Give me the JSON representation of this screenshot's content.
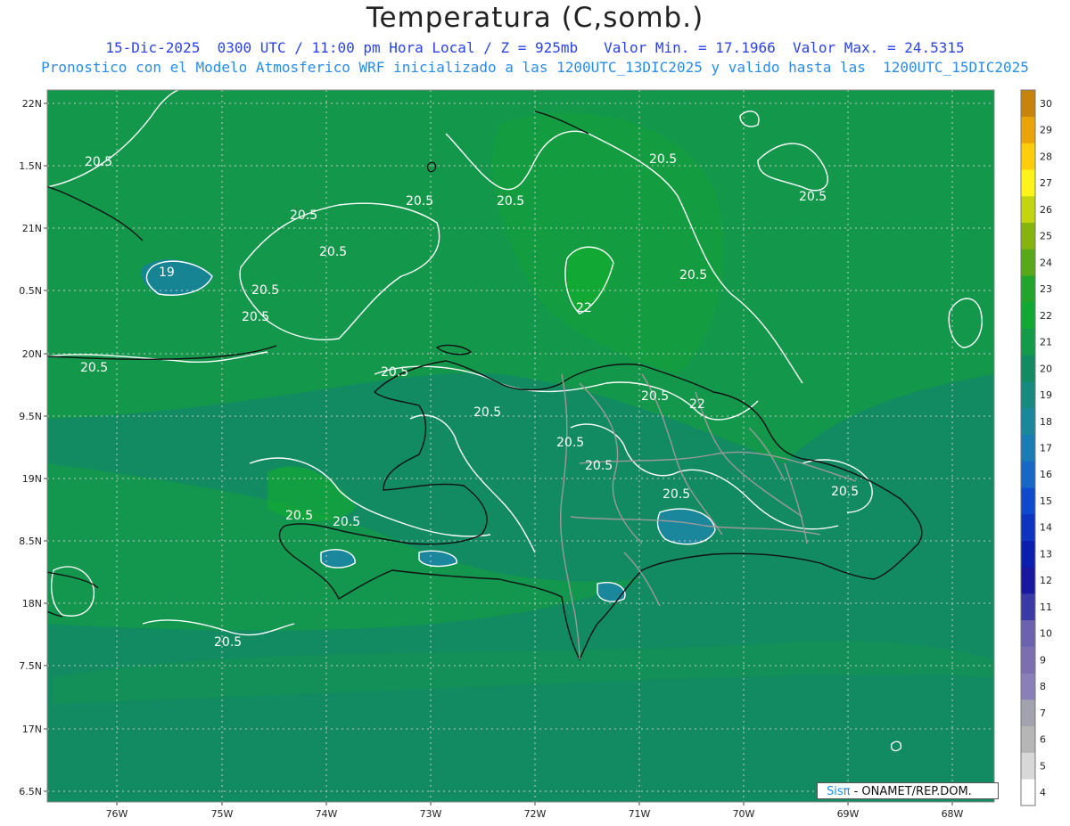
{
  "header": {
    "title": "Temperatura (C,somb.)",
    "subtitle1": "15-Dic-2025  0300 UTC / 11:00 pm Hora Local / Z = 925mb   Valor Min. = 17.1966  Valor Max. = 24.5315",
    "subtitle2": "Pronostico con el Modelo Atmosferico WRF inicializado a las 1200UTC_13DIC2025 y valido hasta las  1200UTC_15DIC2025"
  },
  "axes": {
    "lat_labels": [
      "22N",
      "1.5N",
      "21N",
      "0.5N",
      "20N",
      "9.5N",
      "19N",
      "8.5N",
      "18N",
      "7.5N",
      "17N",
      "6.5N"
    ],
    "lon_labels": [
      "76W",
      "75W",
      "74W",
      "73W",
      "72W",
      "71W",
      "70W",
      "69W",
      "68W"
    ]
  },
  "colorbar": {
    "labels": [
      "4",
      "5",
      "6",
      "7",
      "8",
      "9",
      "10",
      "11",
      "12",
      "13",
      "14",
      "15",
      "16",
      "17",
      "18",
      "19",
      "20",
      "21",
      "22",
      "23",
      "24",
      "25",
      "26",
      "27",
      "28",
      "29",
      "30"
    ],
    "colors": [
      "#ffffff",
      "#d8d8d8",
      "#b6b6b6",
      "#a3a3b0",
      "#8a7fb8",
      "#7b6fb2",
      "#6a62b0",
      "#3a3aa6",
      "#1717a0",
      "#0b1fae",
      "#0c34be",
      "#0d4bcc",
      "#1667c6",
      "#1a7cb4",
      "#1b879d",
      "#17897f",
      "#128a62",
      "#149a48",
      "#12a834",
      "#22a52a",
      "#58a91a",
      "#86b40f",
      "#c3d510",
      "#fff41a",
      "#ffcd0a",
      "#eba30a",
      "#c7840c"
    ]
  },
  "contours": {
    "labels": [
      "20.5",
      "20.5",
      "20.5",
      "20.5",
      "20.5",
      "20.5",
      "20.5",
      "20.5",
      "20.5",
      "20.5",
      "20.5",
      "20.5",
      "20.5",
      "20.5",
      "20.5",
      "20.5",
      "20.5",
      "20.5",
      "20.5",
      "20.5",
      "20.5",
      "22",
      "22",
      "19"
    ]
  },
  "credit": {
    "sis": "Sisπ",
    "rest": "- ONAMET/REP.DOM."
  },
  "colors": {
    "background_green": "#128a62",
    "mid_green": "#149a48",
    "bright_green": "#12a834",
    "cool_teal": "#1a7cb4"
  }
}
